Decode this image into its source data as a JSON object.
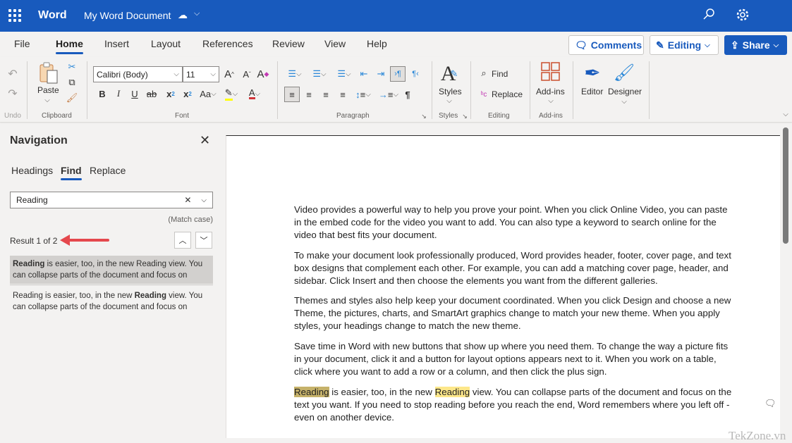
{
  "titlebar": {
    "app_name": "Word",
    "doc_name": "My Word Document",
    "bg": "#185abd"
  },
  "tabs": [
    {
      "label": "File"
    },
    {
      "label": "Home",
      "active": true
    },
    {
      "label": "Insert"
    },
    {
      "label": "Layout"
    },
    {
      "label": "References"
    },
    {
      "label": "Review"
    },
    {
      "label": "View"
    },
    {
      "label": "Help"
    }
  ],
  "header_buttons": {
    "comments": "Comments",
    "editing": "Editing",
    "share": "Share"
  },
  "ribbon": {
    "undo_group": "Undo",
    "clipboard": {
      "paste": "Paste",
      "group": "Clipboard"
    },
    "font": {
      "name": "Calibri (Body)",
      "size": "11",
      "group": "Font",
      "change_case": "Aa"
    },
    "paragraph": {
      "group": "Paragraph"
    },
    "styles": {
      "label": "Styles",
      "group": "Styles"
    },
    "editing": {
      "find": "Find",
      "replace": "Replace",
      "group": "Editing"
    },
    "addins": {
      "label": "Add-ins",
      "group": "Add-ins"
    },
    "editor": "Editor",
    "designer": "Designer"
  },
  "navigation": {
    "title": "Navigation",
    "tabs": [
      "Headings",
      "Find",
      "Replace"
    ],
    "active_tab": "Find",
    "search_value": "Reading",
    "match_case": "(Match case)",
    "result_count": "Result 1 of 2",
    "results": [
      {
        "bold": "Reading",
        "before": "",
        "after": " is easier, too, in the new Reading view. You can collapse parts of the document and focus on"
      },
      {
        "before": "Reading is easier, too, in the new ",
        "bold": "Reading",
        "after": " view. You can collapse parts of the document and focus on"
      }
    ]
  },
  "document": {
    "paragraphs": [
      "Video provides a powerful way to help you prove your point. When you click Online Video, you can paste in the embed code for the video you want to add. You can also type a keyword to search online for the video that best fits your document.",
      "To make your document look professionally produced, Word provides header, footer, cover page, and text box designs that complement each other. For example, you can add a matching cover page, header, and sidebar. Click Insert and then choose the elements you want from the different galleries.",
      "Themes and styles also help keep your document coordinated. When you click Design and choose a new Theme, the pictures, charts, and SmartArt graphics change to match your new theme. When you apply styles, your headings change to match the new theme.",
      "Save time in Word with new buttons that show up where you need them. To change the way a picture fits in your document, click it and a button for layout options appears next to it. When you work on a table, click where you want to add a row or a column, and then click the plus sign."
    ],
    "last_para": {
      "hl1": "Reading",
      "mid": " is easier, too, in the new ",
      "hl2": "Reading",
      "rest": " view. You can collapse parts of the document and focus on the text you want. If you need to stop reading before you reach the end, Word remembers where you left off - even on another device."
    },
    "watermark": "TekZone.vn"
  }
}
